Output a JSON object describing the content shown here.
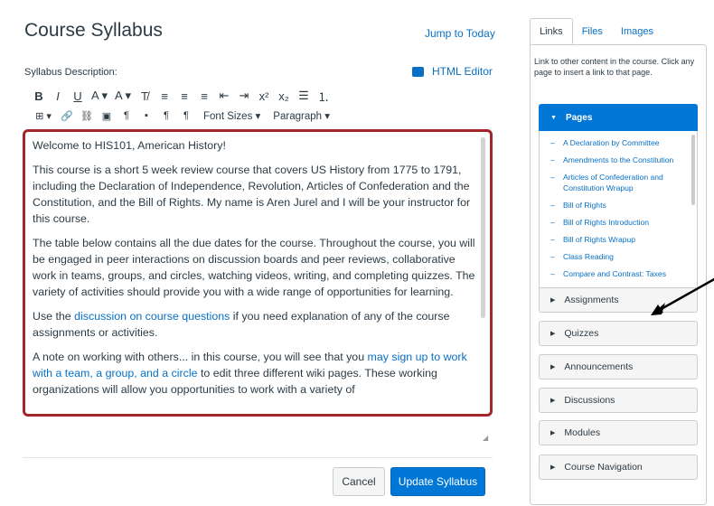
{
  "page": {
    "title": "Course Syllabus",
    "jump_to_today": "Jump to Today",
    "description_label": "Syllabus Description:",
    "html_editor_label": "HTML Editor",
    "html_editor_icon": "html-editor-icon"
  },
  "toolbar": {
    "row1": [
      {
        "name": "bold-button",
        "glyph": "B"
      },
      {
        "name": "italic-button",
        "glyph": "I"
      },
      {
        "name": "underline-button",
        "glyph": "U"
      },
      {
        "name": "text-color-button",
        "glyph": "A ▾"
      },
      {
        "name": "background-color-button",
        "glyph": "A ▾"
      },
      {
        "name": "clear-formatting-button",
        "glyph": "T̸"
      },
      {
        "name": "align-left-button",
        "glyph": "≡"
      },
      {
        "name": "align-center-button",
        "glyph": "≡"
      },
      {
        "name": "align-right-button",
        "glyph": "≡"
      },
      {
        "name": "outdent-button",
        "glyph": "⇤"
      },
      {
        "name": "indent-button",
        "glyph": "⇥"
      },
      {
        "name": "superscript-button",
        "glyph": "x²"
      },
      {
        "name": "subscript-button",
        "glyph": "x₂"
      },
      {
        "name": "bullet-list-button",
        "glyph": "☰"
      },
      {
        "name": "numbered-list-button",
        "glyph": "⒈"
      }
    ],
    "row2": [
      {
        "name": "table-button",
        "glyph": "⊞ ▾"
      },
      {
        "name": "link-button",
        "glyph": "🔗"
      },
      {
        "name": "unlink-button",
        "glyph": "⛓"
      },
      {
        "name": "image-button",
        "glyph": "▣"
      },
      {
        "name": "paragraph-button",
        "glyph": "¶"
      },
      {
        "name": "media-button",
        "glyph": "▪"
      },
      {
        "name": "ltr-button",
        "glyph": "¶"
      },
      {
        "name": "rtl-button",
        "glyph": "¶"
      }
    ],
    "font_sizes_label": "Font Sizes ▾",
    "paragraph_label": "Paragraph ▾"
  },
  "editor": {
    "p1": "Welcome to HIS101, American History!",
    "p2": "This course is a short 5 week review course that covers US History from 1775 to 1791, including the Declaration of Independence, Revolution, Articles of Confederation and the Constitution, and the Bill of Rights. My name is Aren Jurel and I will be your instructor for this course.",
    "p3": "The table below contains all the due dates for the course. Throughout the course, you will be engaged in peer interactions on discussion boards and peer reviews, collaborative work in teams, groups, and circles, watching videos, writing, and completing quizzes. The variety of activities should provide you with a wide range of opportunities for learning.",
    "p4_pre": "Use the ",
    "p4_link": "discussion on course questions",
    "p4_post": " if you need explanation of any of the course assignments or activities.",
    "p5_pre": "A note on working with others... in this course, you will see that you ",
    "p5_link": "may sign up to work with a team, a group, and a circle",
    "p5_post": " to edit three different wiki pages. These working organizations will allow you opportunities to work with a variety of"
  },
  "buttons": {
    "cancel": "Cancel",
    "update": "Update Syllabus"
  },
  "sidebar": {
    "tabs": [
      "Links",
      "Files",
      "Images"
    ],
    "help_text": "Link to other content in the course. Click any page to insert a link to that page.",
    "pages_label": "Pages",
    "pages": [
      "A Declaration by Committee",
      "Amendments to the Constitution",
      "Articles of Confederation and Constitution Wrapup",
      "Bill of Rights",
      "Bill of Rights Introduction",
      "Bill of Rights Wrapup",
      "Class Reading",
      "Compare and Contrast: Taxes"
    ],
    "sections": [
      "Assignments",
      "Quizzes",
      "Announcements",
      "Discussions",
      "Modules",
      "Course Navigation"
    ]
  },
  "colors": {
    "accent": "#0077d6",
    "link": "#0770c5",
    "editor_border": "#a3262b"
  }
}
